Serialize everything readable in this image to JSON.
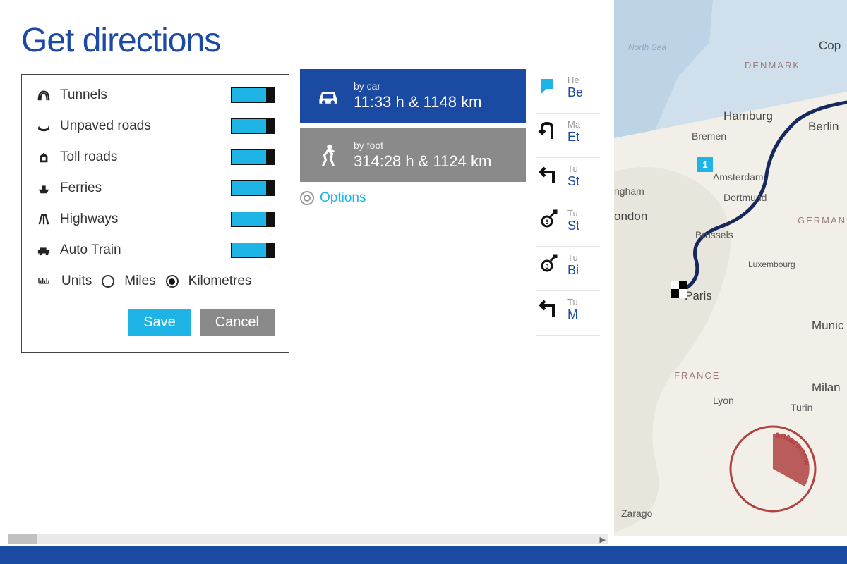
{
  "title": "Get directions",
  "options": {
    "items": [
      {
        "icon": "tunnel",
        "label": "Tunnels",
        "on": true
      },
      {
        "icon": "unpaved",
        "label": "Unpaved roads",
        "on": true
      },
      {
        "icon": "toll",
        "label": "Toll roads",
        "on": true
      },
      {
        "icon": "ferry",
        "label": "Ferries",
        "on": true
      },
      {
        "icon": "highway",
        "label": "Highways",
        "on": true
      },
      {
        "icon": "autotrain",
        "label": "Auto Train",
        "on": true
      }
    ],
    "units_label": "Units",
    "unit_miles": "Miles",
    "unit_km": "Kilometres",
    "selected_unit": "km",
    "save": "Save",
    "cancel": "Cancel"
  },
  "routes": {
    "car": {
      "mode": "by car",
      "detail": "11:33 h & 1148 km"
    },
    "foot": {
      "mode": "by foot",
      "detail": "314:28 h & 1124 km"
    },
    "options_link": "Options"
  },
  "directions": [
    {
      "icon": "start",
      "sub": "He",
      "main": "Be"
    },
    {
      "icon": "uturn",
      "sub": "Ma",
      "main": "Et"
    },
    {
      "icon": "turn-left",
      "sub": "Tu",
      "main": "St"
    },
    {
      "icon": "roundabout",
      "sub": "Tu",
      "main": "St"
    },
    {
      "icon": "roundabout",
      "sub": "Tu",
      "main": "Bi"
    },
    {
      "icon": "turn-left",
      "sub": "Tu",
      "main": "M"
    }
  ],
  "map": {
    "sea": "North Sea",
    "countries": [
      "DENMARK",
      "GERMAN",
      "FRANCE"
    ],
    "cities": [
      "Cop",
      "Hamburg",
      "Bremen",
      "Berlin",
      "Amsterdam",
      "Dortmund",
      "ngham",
      "ondon",
      "Brussels",
      "Luxembourg",
      "Paris",
      "Munic",
      "Milan",
      "Turin",
      "Lyon",
      "Zarago"
    ],
    "pin": "1",
    "route_from": "Berlin",
    "route_to": "Paris"
  },
  "watermark": "antaranews.com"
}
